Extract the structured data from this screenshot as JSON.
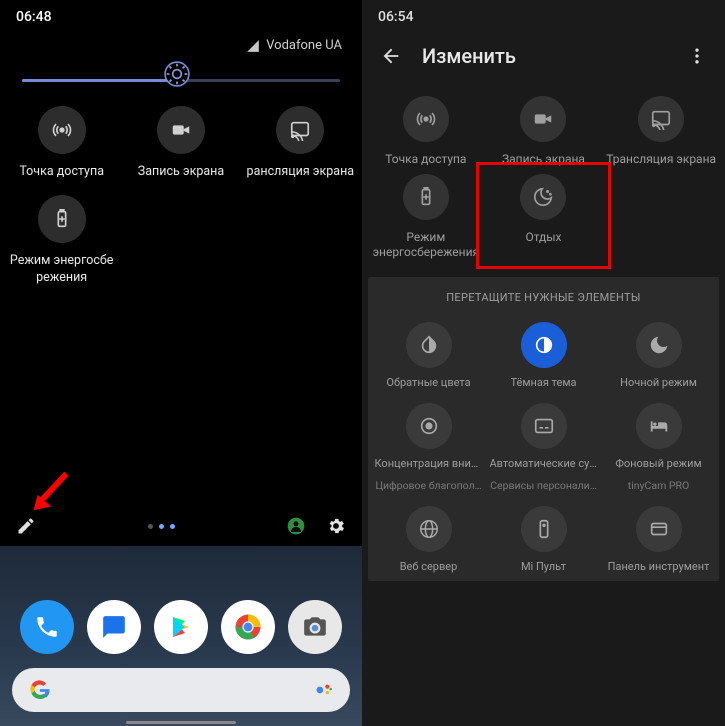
{
  "left": {
    "time": "06:48",
    "carrier": "Vodafone UA",
    "tiles": [
      {
        "label": "Точка доступа"
      },
      {
        "label": "Запись экрана"
      },
      {
        "label": "рансляция экрана"
      },
      {
        "label": "Режим энергосбе\nрежения"
      }
    ]
  },
  "right": {
    "time": "06:54",
    "title": "Изменить",
    "tiles": [
      {
        "label": "Точка доступа"
      },
      {
        "label": "Запись экрана"
      },
      {
        "label": "Трансляция экрана"
      },
      {
        "label": "Режим\nэнергосбережения"
      },
      {
        "label": "Отдых"
      }
    ],
    "drag_title": "ПЕРЕТАЩИТЕ НУЖНЫЕ ЭЛЕМЕНТЫ",
    "drag_tiles": [
      {
        "label": "Обратные цвета",
        "sub": ""
      },
      {
        "label": "Тёмная тема",
        "sub": ""
      },
      {
        "label": "Ночной режим",
        "sub": ""
      },
      {
        "label": "Концентрация вним…",
        "sub": "Цифровое благопол…"
      },
      {
        "label": "Автоматические суб…",
        "sub": "Сервисы персонали…"
      },
      {
        "label": "Фоновый режим",
        "sub": "tinyCam PRO"
      },
      {
        "label": "Веб сервер",
        "sub": ""
      },
      {
        "label": "Mi Пульт",
        "sub": ""
      },
      {
        "label": "Панель инструмент",
        "sub": ""
      }
    ]
  }
}
